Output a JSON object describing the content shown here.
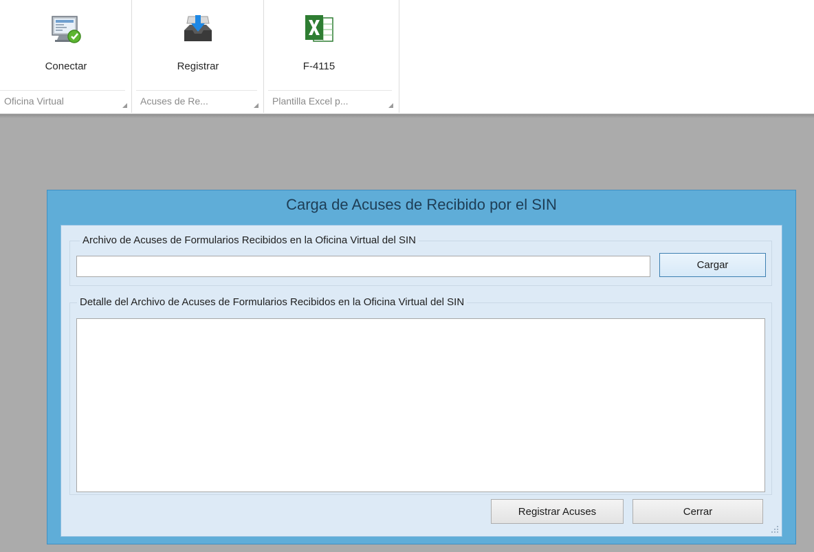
{
  "ribbon": {
    "groups": [
      {
        "button_label": "Conectar",
        "group_label": "Oficina Virtual"
      },
      {
        "button_label": "Registrar",
        "group_label": "Acuses de Re..."
      },
      {
        "button_label": "F-4115",
        "group_label": "Plantilla Excel p..."
      }
    ]
  },
  "dialog": {
    "title": "Carga de Acuses de Recibido por el SIN",
    "file_group": {
      "title": "Archivo de Acuses de Formularios Recibidos en la Oficina Virtual del SIN",
      "file_path_value": "",
      "load_button": "Cargar"
    },
    "detail_group": {
      "title": "Detalle del  Archivo de Acuses de Formularios Recibidos en la Oficina Virtual del SIN",
      "content": ""
    },
    "register_button": "Registrar Acuses",
    "close_button": "Cerrar"
  },
  "colors": {
    "dialog_frame": "#5fadd8",
    "dialog_inner": "#ddeaf6",
    "workspace": "#ababab"
  }
}
